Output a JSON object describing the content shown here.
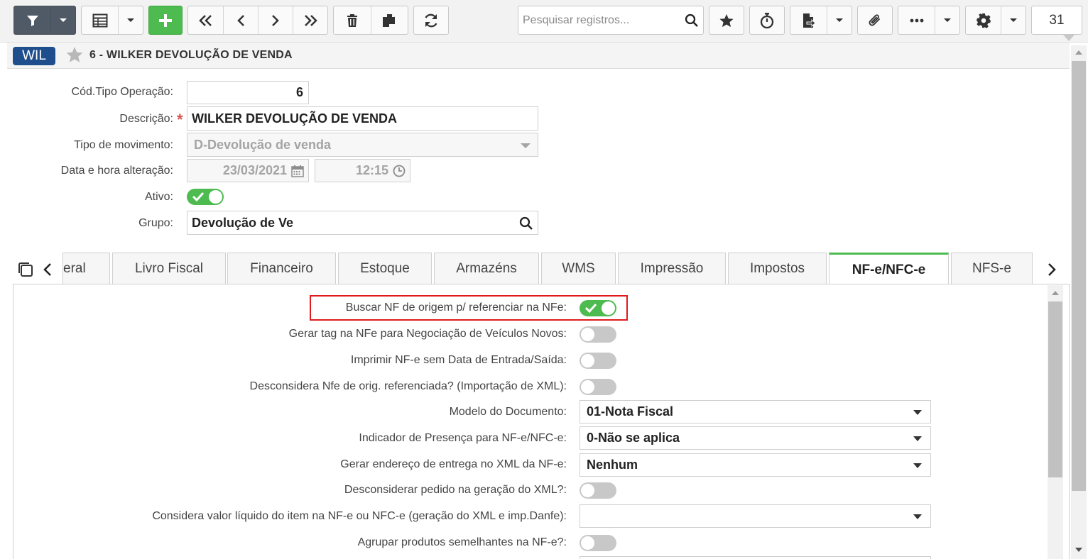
{
  "toolbar": {
    "search": {
      "placeholder": "Pesquisar registros..."
    },
    "counter": "31",
    "icons": [
      "filter-icon",
      "grid-icon",
      "plus-icon",
      "first-record-icon",
      "prev-record-icon",
      "next-record-icon",
      "last-record-icon",
      "trash-icon",
      "copy-icon",
      "refresh-icon",
      "search-icon",
      "star-icon",
      "stopwatch-icon",
      "export-icon",
      "paperclip-icon",
      "more-icon",
      "gear-icon"
    ]
  },
  "header": {
    "badge": "WIL",
    "title": "6 - WILKER DEVOLUÇÃO DE VENDA"
  },
  "form": {
    "cod_tipo": {
      "label": "Cód.Tipo Operação:",
      "value": "6"
    },
    "descricao": {
      "label": "Descrição:",
      "required_mark": "*",
      "value": "WILKER DEVOLUÇÃO DE VENDA"
    },
    "tipo_movimento": {
      "label": "Tipo de movimento:",
      "value": "D-Devolução de venda"
    },
    "data_hora": {
      "label": "Data e hora alteração:",
      "date": "23/03/2021",
      "time": "12:15"
    },
    "ativo": {
      "label": "Ativo:",
      "on": true
    },
    "grupo": {
      "label": "Grupo:",
      "value": "Devolução de Ve"
    }
  },
  "tabs": [
    {
      "label": "Geral",
      "visible": "eral",
      "active": false
    },
    {
      "label": "Livro Fiscal",
      "active": false
    },
    {
      "label": "Financeiro",
      "active": false
    },
    {
      "label": "Estoque",
      "active": false
    },
    {
      "label": "Armazéns",
      "active": false
    },
    {
      "label": "WMS",
      "active": false
    },
    {
      "label": "Impressão",
      "active": false
    },
    {
      "label": "Impostos",
      "active": false
    },
    {
      "label": "NF-e/NFC-e",
      "active": true
    },
    {
      "label": "NFS-e",
      "active": false
    }
  ],
  "panel": {
    "rows": [
      {
        "label": "Buscar NF de origem p/ referenciar na NFe:",
        "type": "toggle",
        "on": true,
        "highlighted": true
      },
      {
        "label": "Gerar tag na NFe para Negociação de Veículos Novos:",
        "type": "toggle",
        "on": false
      },
      {
        "label": "Imprimir NF-e sem Data de Entrada/Saída:",
        "type": "toggle",
        "on": false
      },
      {
        "label": "Desconsidera Nfe de orig. referenciada? (Importação de XML):",
        "type": "toggle",
        "on": false
      },
      {
        "label": "Modelo do Documento:",
        "type": "select",
        "value": "01-Nota Fiscal"
      },
      {
        "label": "Indicador de Presença para NF-e/NFC-e:",
        "type": "select",
        "value": "0-Não se aplica"
      },
      {
        "label": "Gerar endereço de entrega no XML da NF-e:",
        "type": "select",
        "value": "Nenhum"
      },
      {
        "label": "Desconsiderar pedido na geração do XML?:",
        "type": "toggle",
        "on": false
      },
      {
        "label": "Considera valor líquido do item na NF-e ou NFC-e (geração do XML e imp.Danfe):",
        "type": "select",
        "value": ""
      },
      {
        "label": "Agrupar produtos semelhantes na NF-e?:",
        "type": "toggle",
        "on": false
      }
    ]
  },
  "colors": {
    "accent_green": "#4dbb4f",
    "badge_blue": "#1f4e8c",
    "highlight_red": "#e01b1b",
    "filter_button": "#505a66"
  }
}
